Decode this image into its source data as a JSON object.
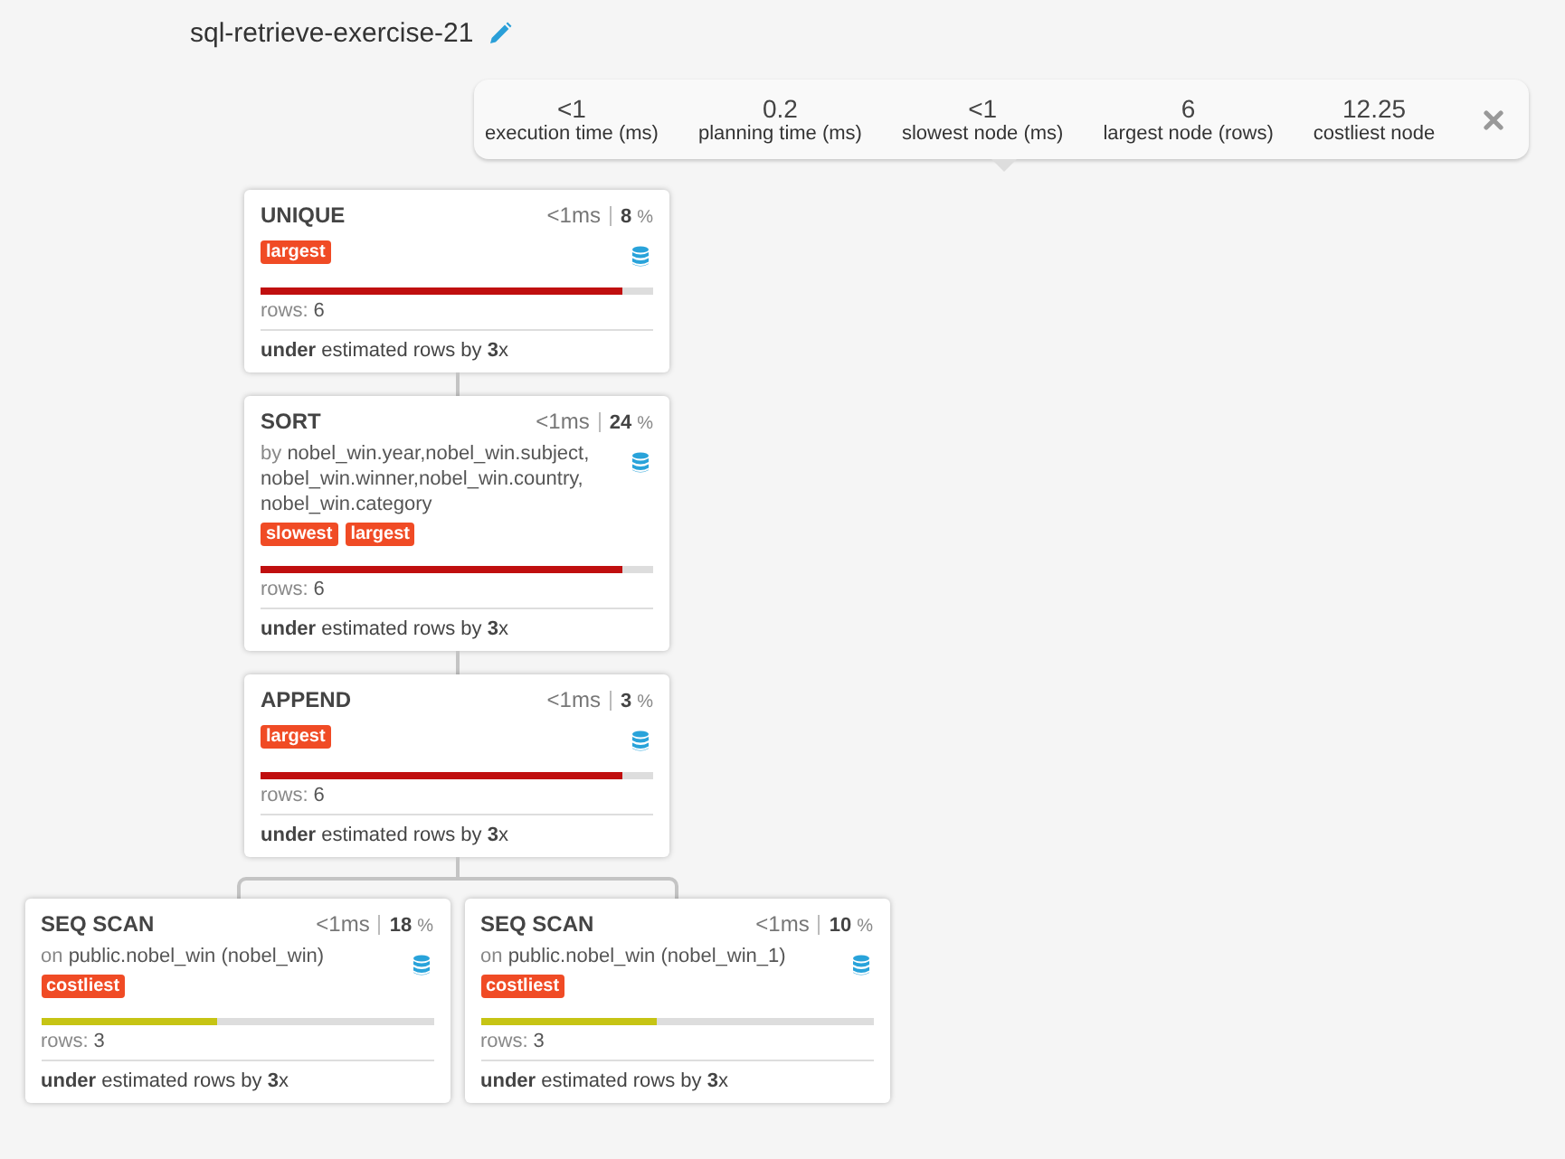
{
  "title": "sql-retrieve-exercise-21",
  "stats": [
    {
      "value": "<1",
      "label": "execution time (ms)"
    },
    {
      "value": "0.2",
      "label": "planning time (ms)"
    },
    {
      "value": "<1",
      "label": "slowest node (ms)"
    },
    {
      "value": "6",
      "label": "largest node (rows)"
    },
    {
      "value": "12.25",
      "label": "costliest node"
    }
  ],
  "plan": {
    "title": "UNIQUE",
    "time": "<1ms",
    "percent": "8",
    "percent_sign": "%",
    "tags": [
      "largest"
    ],
    "level": 0.92,
    "color": "#c00f0f",
    "rows_label": "rows:",
    "rows": "6",
    "estimate": "**under** estimated rows by **3**x",
    "children": [
      {
        "title": "SORT",
        "time": "<1ms",
        "percent": "24",
        "percent_sign": "%",
        "detail_prefix": "by",
        "detail": "nobel_win.year,nobel_win.subject, nobel_win.winner,nobel_win.country, nobel_win.category",
        "tags": [
          "slowest",
          "largest"
        ],
        "level": 0.92,
        "color": "#c00f0f",
        "rows_label": "rows:",
        "rows": "6",
        "estimate": "**under** estimated rows by **3**x",
        "children": [
          {
            "title": "APPEND",
            "time": "<1ms",
            "percent": "3",
            "percent_sign": "%",
            "tags": [
              "largest"
            ],
            "level": 0.92,
            "color": "#c00f0f",
            "rows_label": "rows:",
            "rows": "6",
            "estimate": "**under** estimated rows by **3**x",
            "children": [
              {
                "title": "SEQ SCAN",
                "time": "<1ms",
                "percent": "18",
                "percent_sign": "%",
                "detail_prefix": "on",
                "detail": "public.nobel_win (nobel_win)",
                "tags": [
                  "costliest"
                ],
                "level": 0.45,
                "color": "#c6c414",
                "rows_label": "rows:",
                "rows": "3",
                "estimate": "**under** estimated rows by **3**x"
              },
              {
                "title": "SEQ SCAN",
                "time": "<1ms",
                "percent": "10",
                "percent_sign": "%",
                "detail_prefix": "on",
                "detail": "public.nobel_win (nobel_win_1)",
                "tags": [
                  "costliest"
                ],
                "level": 0.45,
                "color": "#c6c414",
                "rows_label": "rows:",
                "rows": "3",
                "estimate": "**under** estimated rows by **3**x"
              }
            ]
          }
        ]
      }
    ]
  }
}
